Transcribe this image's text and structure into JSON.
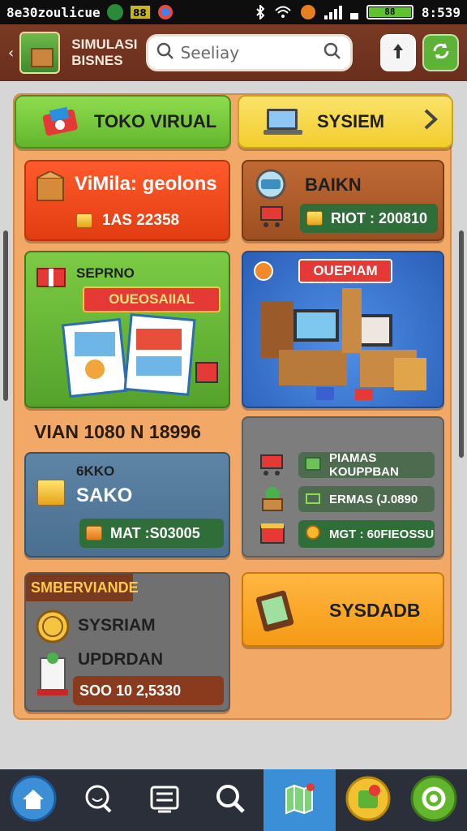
{
  "status_bar": {
    "left_text": "8e30zoulicue",
    "time": "8:539",
    "battery_text": "88"
  },
  "header": {
    "back_icon": "chevron-left-icon",
    "title_line1": "SIMULASI",
    "title_line2": "BISNES",
    "search_placeholder": "Seeliay",
    "buttons": [
      {
        "icon": "upload-icon"
      },
      {
        "icon": "refresh-icon"
      }
    ]
  },
  "tabs": [
    {
      "label": "TOKO VIRUAL",
      "icon": "ticket-icon",
      "color": "#6bbf32"
    },
    {
      "label": "SYSIEM",
      "icon": "laptop-icon",
      "color": "#f4d33a",
      "chevron": "chevron-right-icon"
    }
  ],
  "cards": {
    "orange": {
      "title": "ViMila: geolons",
      "stat": "1AS 22358"
    },
    "bank": {
      "title": "BAIKN",
      "stat": "RIOT : 200810"
    },
    "promo": {
      "label": "SEPRNO",
      "banner": "OUEOSAIIAL"
    },
    "store": {
      "banner": "OUEPIAM"
    },
    "section_heading": "VIAN 1080 N 18996",
    "sako": {
      "line1": "6KKO",
      "line2": "SAKO",
      "stat": "MAT :S03005"
    },
    "list": {
      "items": [
        {
          "label": "PIAMAS KOUPPBAN"
        },
        {
          "label": "ERMAS (J.0890"
        },
        {
          "label": "MGT : 60FIEOSSU"
        }
      ]
    },
    "server": {
      "badge": "SMBERVIANDE",
      "line1": "SYSRIAM",
      "line2": "UPDRDAN",
      "stat": "SOO 10 2,5330"
    },
    "sysadb": {
      "label": "SYSDADB"
    }
  },
  "bottom_nav": [
    {
      "icon": "home-icon"
    },
    {
      "icon": "chat-search-icon"
    },
    {
      "icon": "list-icon"
    },
    {
      "icon": "search-icon"
    },
    {
      "icon": "map-icon"
    },
    {
      "icon": "wallet-icon"
    },
    {
      "icon": "settings-icon"
    }
  ]
}
